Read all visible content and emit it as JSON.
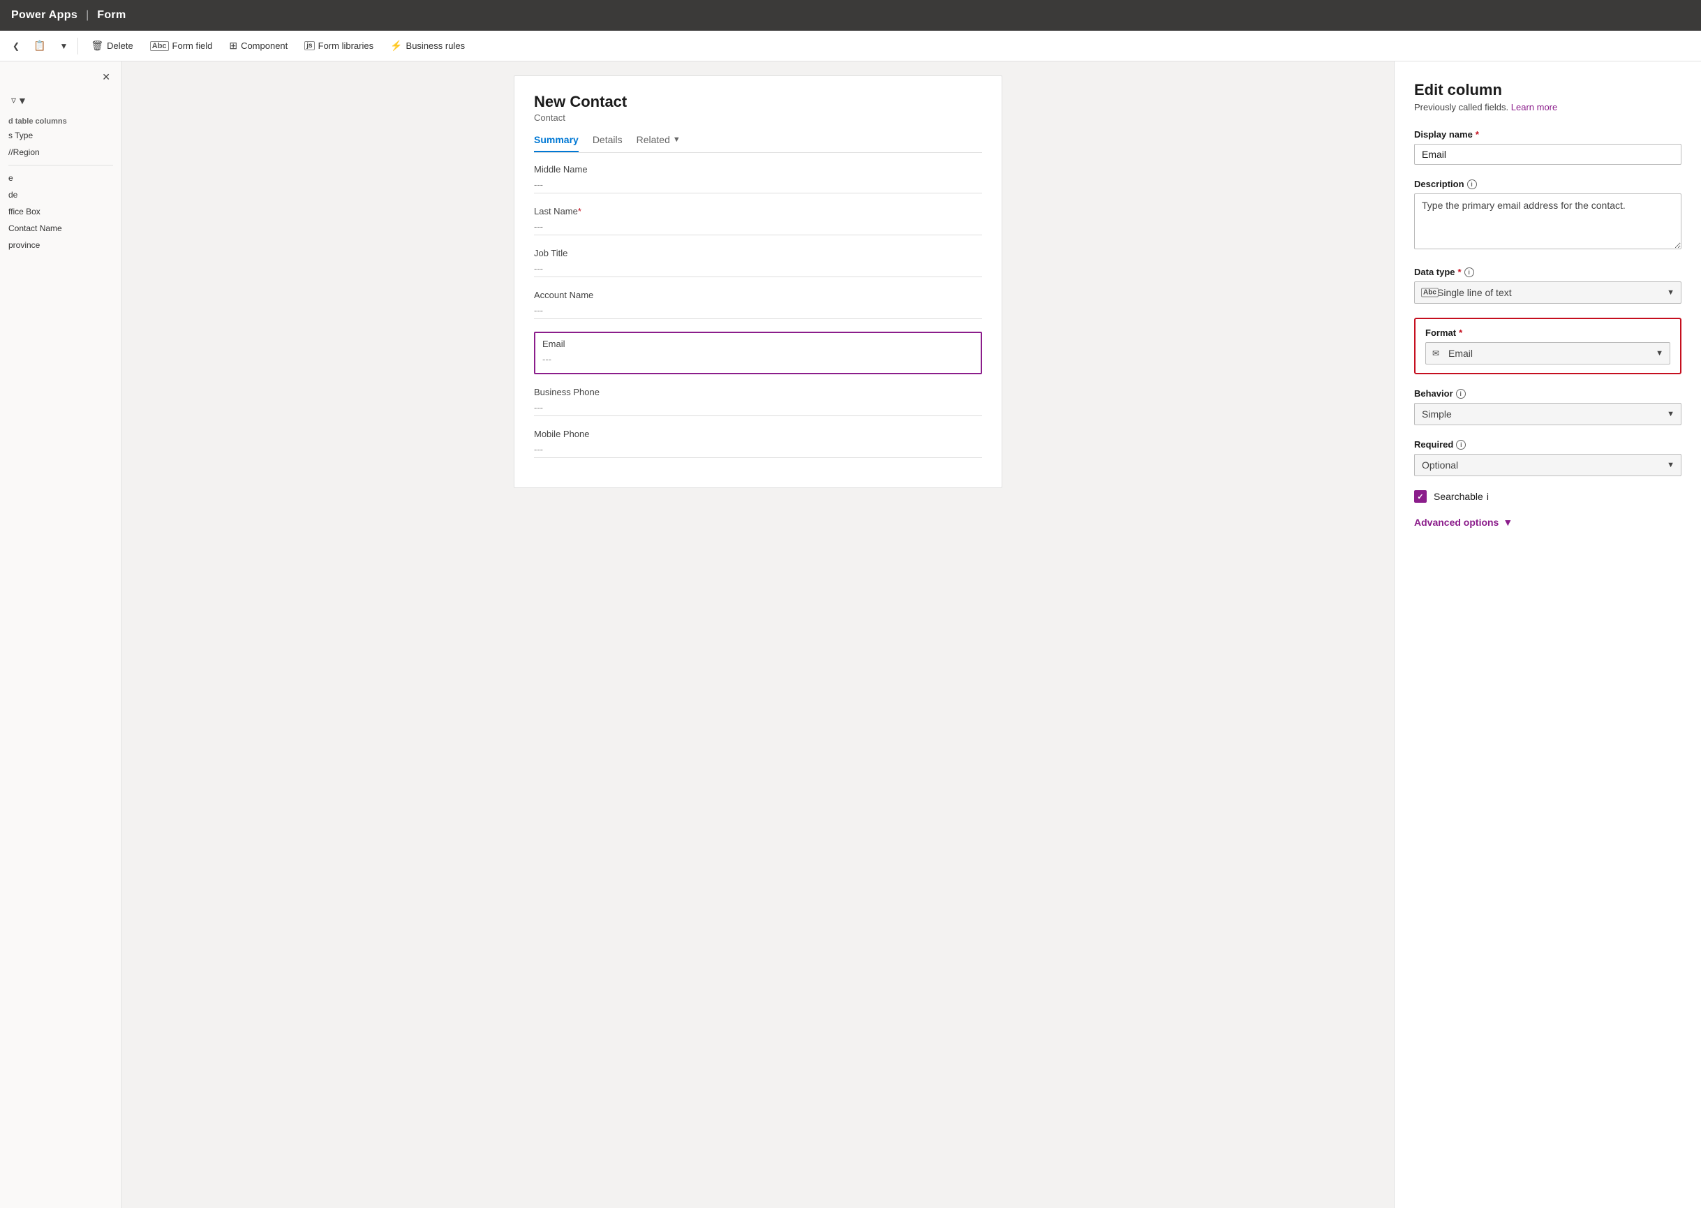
{
  "app": {
    "title": "Power Apps",
    "separator": "|",
    "section": "Form"
  },
  "toolbar": {
    "delete_label": "Delete",
    "form_field_label": "Form field",
    "component_label": "Component",
    "form_libraries_label": "Form libraries",
    "business_rules_label": "Business rules"
  },
  "sidebar": {
    "section_label": "d table columns",
    "items": [
      {
        "label": "s Type"
      },
      {
        "label": "//Region"
      },
      {
        "label": ""
      },
      {
        "label": ""
      },
      {
        "label": "e"
      },
      {
        "label": "de"
      },
      {
        "label": ""
      },
      {
        "label": "ffice Box"
      },
      {
        "label": "Contact Name"
      },
      {
        "label": "province"
      }
    ]
  },
  "form": {
    "title": "New Contact",
    "subtitle": "Contact",
    "tabs": [
      {
        "label": "Summary",
        "active": true
      },
      {
        "label": "Details",
        "active": false
      },
      {
        "label": "Related",
        "active": false,
        "has_chevron": true
      }
    ],
    "fields": [
      {
        "label": "Middle Name",
        "value": "---",
        "required": false,
        "selected": false
      },
      {
        "label": "Last Name",
        "value": "---",
        "required": true,
        "selected": false
      },
      {
        "label": "Job Title",
        "value": "---",
        "required": false,
        "selected": false
      },
      {
        "label": "Account Name",
        "value": "---",
        "required": false,
        "selected": false
      },
      {
        "label": "Email",
        "value": "---",
        "required": false,
        "selected": true
      },
      {
        "label": "Business Phone",
        "value": "---",
        "required": false,
        "selected": false
      },
      {
        "label": "Mobile Phone",
        "value": "---",
        "required": false,
        "selected": false
      }
    ]
  },
  "edit_panel": {
    "title": "Edit column",
    "subtitle": "Previously called fields.",
    "learn_more": "Learn more",
    "display_name_label": "Display name",
    "display_name_req": "*",
    "display_name_value": "Email",
    "description_label": "Description",
    "description_value": "Type the primary email address for the contact.",
    "data_type_label": "Data type",
    "data_type_req": "*",
    "data_type_value": "Single line of text",
    "data_type_icon": "Abc",
    "format_label": "Format",
    "format_req": "*",
    "format_value": "Email",
    "format_icon": "✉",
    "behavior_label": "Behavior",
    "behavior_value": "Simple",
    "required_label": "Required",
    "required_value": "Optional",
    "searchable_label": "Searchable",
    "searchable_checked": true,
    "advanced_options_label": "Advanced options"
  },
  "icons": {
    "close": "✕",
    "filter": "⊞",
    "chevron_down": "▾",
    "chevron_down_small": "▾",
    "info": "i",
    "delete": "🗑",
    "form_field_icon": "Abc",
    "component": "⊞",
    "form_libraries_icon": "js",
    "business_rules_icon": "⚡",
    "email_icon": "✉",
    "abc_icon": "Abc",
    "check": "✓",
    "envelope": "✉"
  },
  "colors": {
    "accent": "#8b1d8b",
    "error": "#c50f1f",
    "link": "#8b1d8b",
    "active_tab": "#0078d4"
  }
}
